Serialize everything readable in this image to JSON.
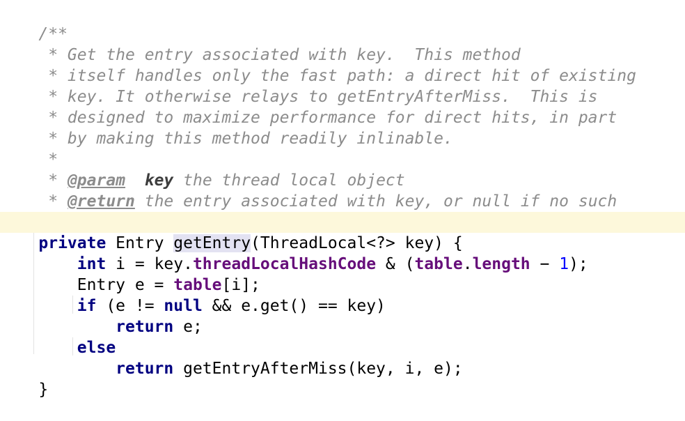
{
  "code": {
    "doc_open": "/**",
    "doc_line_1": " * Get the entry associated with key.  This method",
    "doc_line_2": " * itself handles only the fast path: a direct hit of existing",
    "doc_line_3": " * key. It otherwise relays to getEntryAfterMiss.  This is",
    "doc_line_4": " * designed to maximize performance for direct hits, in part",
    "doc_line_5": " * by making this method readily inlinable.",
    "doc_blank": " *",
    "doc_star": " * ",
    "param_tag": "@param",
    "param_gap": "  ",
    "param_name": "key",
    "param_desc": " the thread local object",
    "return_tag": "@return",
    "return_desc": " the entry associated with key, or null if no such",
    "doc_close": " */",
    "sig_private": "private",
    "sig_type": " Entry ",
    "sig_method": "getEntry",
    "sig_params": "(ThreadLocal<?> key) {",
    "indent_1": "    ",
    "indent_2": "        ",
    "l1_int": "int",
    "l1_a": " i = key.",
    "l1_field": "threadLocalHashCode",
    "l1_b": " & (",
    "l1_table": "table",
    "l1_dot": ".",
    "l1_length": "length",
    "l1_minus": " − ",
    "l1_one": "1",
    "l1_end": ");",
    "l2_a": "Entry e = ",
    "l2_table": "table",
    "l2_b": "[i];",
    "l3_if": "if",
    "l3_a": " (e != ",
    "l3_null": "null",
    "l3_b": " && e.get() == key)",
    "l4_return": "return",
    "l4_rest": " e;",
    "l5_else": "else",
    "l6_return": "return",
    "l6_rest": " getEntryAfterMiss(key, i, e);",
    "close_brace": "}"
  },
  "colors": {
    "comment": "#8c8c8c",
    "keyword": "#000080",
    "field": "#660e7a",
    "number": "#0000ff",
    "caret_line": "#fdf8db",
    "identifier_highlight": "#e3e2f2"
  }
}
